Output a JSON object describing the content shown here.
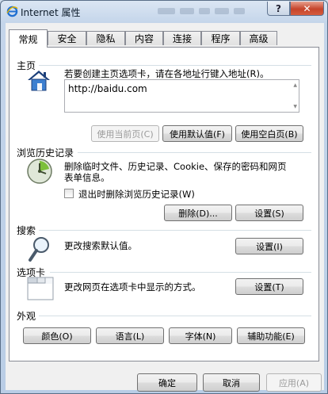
{
  "window": {
    "title": "Internet 属性",
    "help_label": "?",
    "close_label": "✕"
  },
  "tabs": [
    {
      "label": "常规",
      "active": true
    },
    {
      "label": "安全"
    },
    {
      "label": "隐私"
    },
    {
      "label": "内容"
    },
    {
      "label": "连接"
    },
    {
      "label": "程序"
    },
    {
      "label": "高级"
    }
  ],
  "homepage": {
    "title": "主页",
    "description": "若要创建主页选项卡，请在各地址行键入地址(R)。",
    "address": "http://baidu.com",
    "buttons": {
      "use_current": "使用当前页(C)",
      "use_default": "使用默认值(F)",
      "use_blank": "使用空白页(B)"
    }
  },
  "history": {
    "title": "浏览历史记录",
    "description_line1": "删除临时文件、历史记录、Cookie、保存的密码和网页",
    "description_line2": "表单信息。",
    "checkbox_label": "退出时删除浏览历史记录(W)",
    "checkbox_checked": false,
    "delete_button": "删除(D)...",
    "settings_button": "设置(S)"
  },
  "search": {
    "title": "搜索",
    "description": "更改搜索默认值。",
    "settings_button": "设置(I)"
  },
  "tabs_section": {
    "title": "选项卡",
    "description": "更改网页在选项卡中显示的方式。",
    "settings_button": "设置(T)"
  },
  "appearance": {
    "title": "外观",
    "buttons": {
      "colors": "颜色(O)",
      "languages": "语言(L)",
      "fonts": "字体(N)",
      "accessibility": "辅助功能(E)"
    }
  },
  "footer": {
    "ok": "确定",
    "cancel": "取消",
    "apply": "应用(A)"
  },
  "colors": {
    "separator": "#d5dfe5",
    "close_button": "#c6442b"
  }
}
